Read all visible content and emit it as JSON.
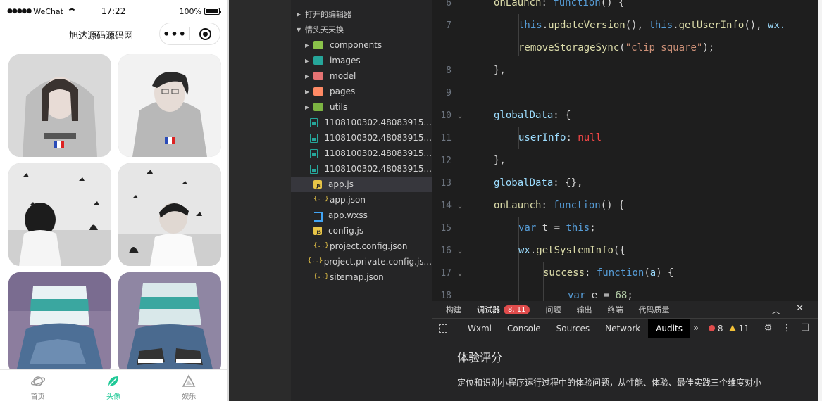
{
  "phone": {
    "status": {
      "carrier": "WeChat",
      "time": "17:22",
      "battery": "100%"
    },
    "nav_title": "旭达源码源码网",
    "capsule": {
      "more": "•••"
    },
    "tabs": [
      {
        "label": "首页",
        "icon": "planet-icon",
        "active": false
      },
      {
        "label": "头像",
        "icon": "leaf-icon",
        "active": true
      },
      {
        "label": "娱乐",
        "icon": "triangle-icon",
        "active": false
      }
    ]
  },
  "explorer": {
    "open_editors": "打开的编辑器",
    "project": "情头天天换",
    "items": [
      {
        "label": "components",
        "type": "folder",
        "color": "green"
      },
      {
        "label": "images",
        "type": "folder",
        "color": "teal"
      },
      {
        "label": "model",
        "type": "folder",
        "color": "red"
      },
      {
        "label": "pages",
        "type": "folder",
        "color": "orange"
      },
      {
        "label": "utils",
        "type": "folder",
        "color": "lime"
      },
      {
        "label": "1108100302.48083915...",
        "type": "img"
      },
      {
        "label": "1108100302.48083915...",
        "type": "img"
      },
      {
        "label": "1108100302.48083915...",
        "type": "img"
      },
      {
        "label": "1108100302.48083915...",
        "type": "img"
      },
      {
        "label": "app.js",
        "type": "js",
        "active": true
      },
      {
        "label": "app.json",
        "type": "json"
      },
      {
        "label": "app.wxss",
        "type": "css"
      },
      {
        "label": "config.js",
        "type": "js"
      },
      {
        "label": "project.config.json",
        "type": "json"
      },
      {
        "label": "project.private.config.js...",
        "type": "json"
      },
      {
        "label": "sitemap.json",
        "type": "json"
      }
    ]
  },
  "editor": {
    "line_numbers": [
      "6",
      "7",
      "8",
      "9",
      "10",
      "11",
      "12",
      "13",
      "14",
      "15",
      "16",
      "17",
      "18"
    ],
    "code": {
      "onLaunch": "onLaunch",
      "function": "function",
      "this1": "this",
      "updateVersion": "updateVersion",
      "this2": "this",
      "getUserInfo": "getUserInfo",
      "wx1": "wx.",
      "removeStorageSync": "removeStorageSync",
      "clip_square": "\"clip_square\"",
      "globalData": "globalData",
      "userInfo": "userInfo",
      "null": "null",
      "var": "var",
      "t": "t",
      "wx2": "wx",
      "getSystemInfo": "getSystemInfo",
      "success": "success",
      "a": "a",
      "e": "e",
      "num68": "68"
    }
  },
  "panel": {
    "tabs": [
      "构建",
      "调试器",
      "问题",
      "输出",
      "终端",
      "代码质量"
    ],
    "badge": "8, 11",
    "devtools_tabs": [
      "Wxml",
      "Console",
      "Sources",
      "Network",
      "Audits"
    ],
    "active_devtool": "Audits",
    "errors": "8",
    "warnings": "11",
    "audit_title": "体验评分",
    "audit_desc": "定位和识别小程序运行过程中的体验问题，从性能、体验、最佳实践三个维度对小"
  }
}
